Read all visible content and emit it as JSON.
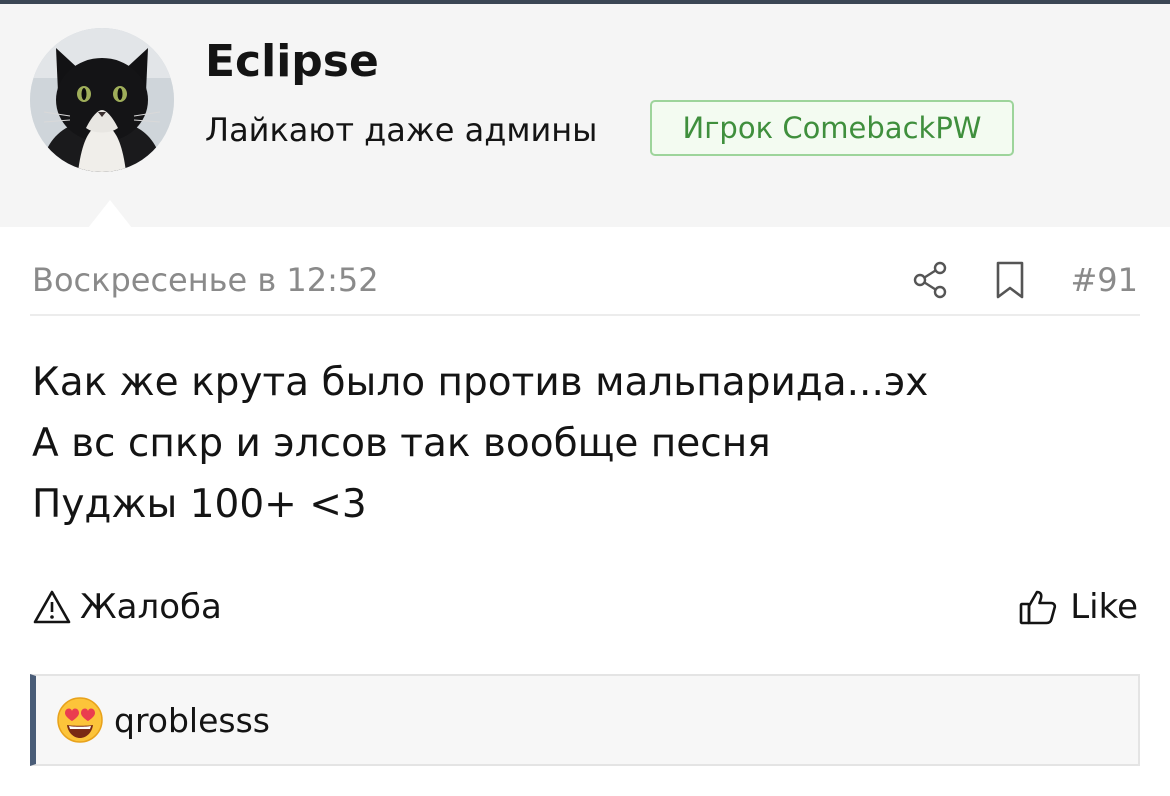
{
  "user": {
    "name": "Eclipse",
    "title": "Лайкают даже админы",
    "banner": "Игрок ComebackPW",
    "avatar_icon": "cat-avatar-icon"
  },
  "post": {
    "date": "Воскресенье в 12:52",
    "number": "#91",
    "share_icon": "share-icon",
    "bookmark_icon": "bookmark-icon",
    "lines": [
      "Как же крута было против мальпарида...эх",
      "А вс спкр и элсов так вообще песня",
      "Пуджы 100+ <3"
    ]
  },
  "actions": {
    "report_label": "Жалоба",
    "like_label": "Like"
  },
  "likes": {
    "reaction_icon": "heart-eyes-emoji",
    "users": "qroblesss"
  },
  "colors": {
    "header_bg": "#f5f5f5",
    "banner_border": "#9dd49b",
    "banner_text": "#3f8f3d",
    "likes_accent": "#4a5d78",
    "muted_text": "#8a8a8a"
  }
}
